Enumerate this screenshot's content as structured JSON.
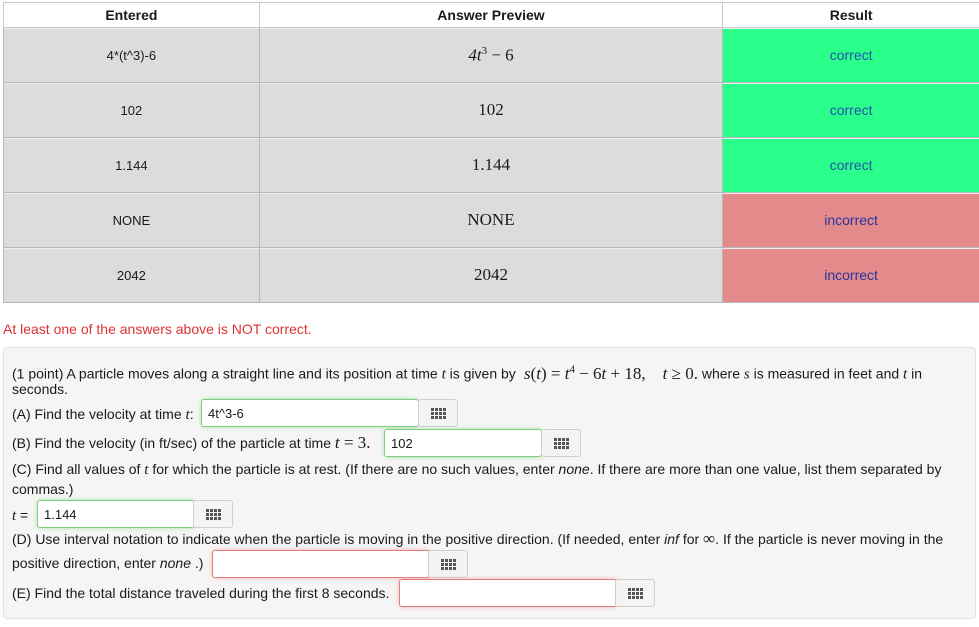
{
  "table": {
    "headers": [
      "Entered",
      "Answer Preview",
      "Result"
    ],
    "rows": [
      {
        "entered": "4*(t^3)-6",
        "result": "correct",
        "status": "correct"
      },
      {
        "entered": "102",
        "preview": "102",
        "result": "correct",
        "status": "correct"
      },
      {
        "entered": "1.144",
        "preview": "1.144",
        "result": "correct",
        "status": "correct"
      },
      {
        "entered": "NONE",
        "preview": "NONE",
        "result": "incorrect",
        "status": "incorrect"
      },
      {
        "entered": "2042",
        "preview": "2042",
        "result": "incorrect",
        "status": "incorrect"
      }
    ]
  },
  "warning": "At least one of the answers above is NOT correct.",
  "problem": {
    "intro_a": "(1 point) A particle moves along a straight line and its position at time",
    "intro_b": "is given by",
    "intro_c": "where",
    "intro_d": "is measured in feet and",
    "intro_e": "in",
    "intro_f": "seconds.",
    "part_a": {
      "label": "(A) Find the velocity at time",
      "value": "4t^3-6"
    },
    "part_b": {
      "label": "(B) Find the velocity (in ft/sec) of the particle at time",
      "value": "102"
    },
    "part_c": {
      "label_a": "(C) Find all values of",
      "label_b": "for which the particle is at rest. (If there are no such values, enter",
      "label_c": ". If there are more than one value, list them separated by",
      "label_d": "commas.)",
      "none_word": "none",
      "value": "1.144"
    },
    "part_d": {
      "label_a": "(D) Use interval notation to indicate when the particle is moving in the positive direction. (If needed, enter",
      "inf_word": "inf",
      "label_b": "for",
      "label_c": ". If the particle is never moving in the",
      "label_d": "positive direction, enter",
      "none_word": "none",
      "label_e": ".)",
      "value": ""
    },
    "part_e": {
      "label": "(E) Find the total distance traveled during the first 8 seconds.",
      "value": ""
    }
  },
  "colors": {
    "correct": "#2aff8c",
    "incorrect": "#e38a8a",
    "warning": "#dd3333"
  },
  "icons": {
    "equation_editor": "grid-icon"
  }
}
